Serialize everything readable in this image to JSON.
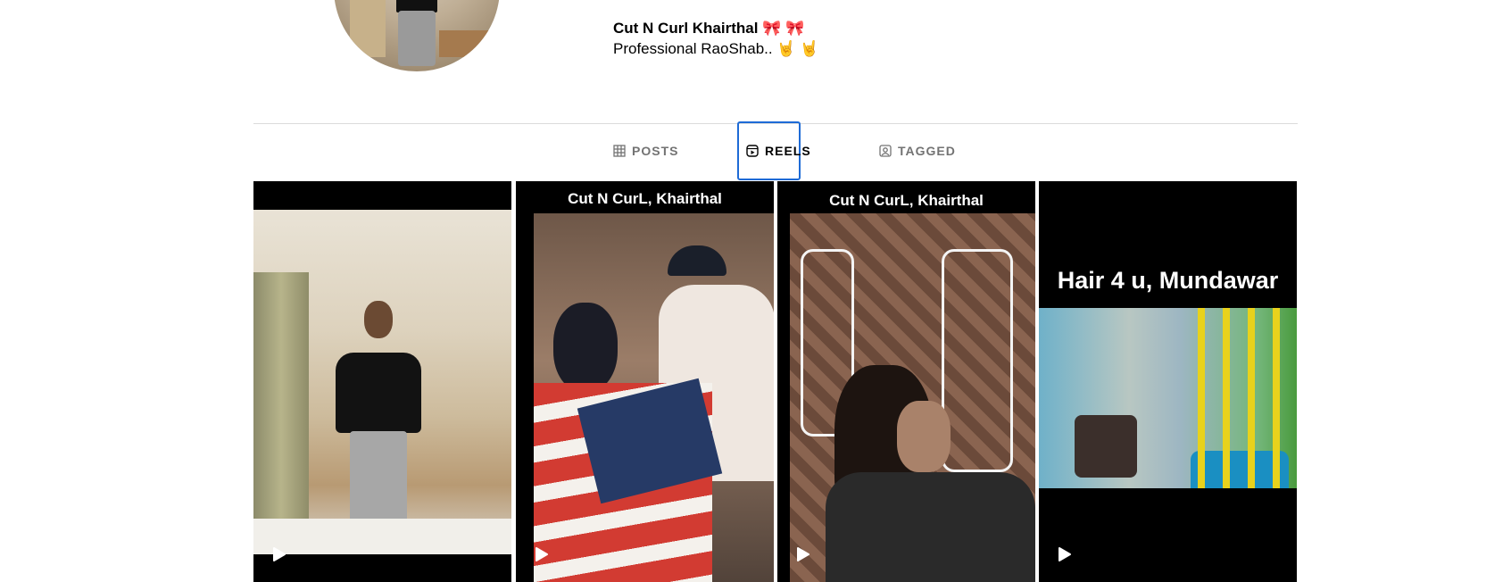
{
  "profile": {
    "name": "Cut N Curl Khairthal 🎀 🎀",
    "bio": "Professional RaoShab.. 🤘 🤘"
  },
  "tabs": [
    {
      "label": "POSTS",
      "icon": "grid-icon",
      "active": false
    },
    {
      "label": "REELS",
      "icon": "reels-icon",
      "active": true
    },
    {
      "label": "TAGGED",
      "icon": "tagged-icon",
      "active": false
    }
  ],
  "reels": [
    {
      "caption": "",
      "icon": "play-icon"
    },
    {
      "caption": "Cut N CurL, Khairthal",
      "icon": "play-icon"
    },
    {
      "caption": "Cut N CurL, Khairthal",
      "icon": "play-icon"
    },
    {
      "caption": "Hair 4 u, Mundawar",
      "icon": "play-icon"
    }
  ],
  "colors": {
    "active_tab_outline": "#1e6bd6",
    "inactive_tab_text": "#737373",
    "divider": "#dbdbdb"
  }
}
